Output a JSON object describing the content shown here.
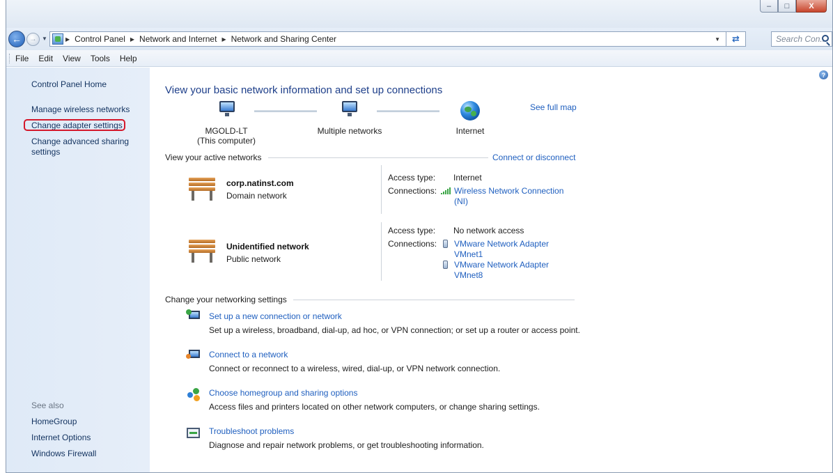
{
  "window": {
    "caption": {
      "minimize": "–",
      "maximize": "□",
      "close": "X"
    }
  },
  "address": {
    "crumbs": [
      "Control Panel",
      "Network and Internet",
      "Network and Sharing Center"
    ],
    "search_placeholder": "Search Con..."
  },
  "menu": [
    "File",
    "Edit",
    "View",
    "Tools",
    "Help"
  ],
  "sidebar": {
    "home": "Control Panel Home",
    "items": [
      "Manage wireless networks",
      "Change adapter settings",
      "Change advanced sharing settings"
    ],
    "see_also_label": "See also",
    "see_also": [
      "HomeGroup",
      "Internet Options",
      "Windows Firewall"
    ]
  },
  "main": {
    "title": "View your basic network information and set up connections",
    "see_full_map": "See full map",
    "map": {
      "computer_name": "MGOLD-LT",
      "computer_sub": "(This computer)",
      "middle": "Multiple networks",
      "internet": "Internet"
    },
    "active_header": "View your active networks",
    "connect_or_disconnect": "Connect or disconnect",
    "networks": [
      {
        "name": "corp.natinst.com",
        "type": "Domain network",
        "access_label": "Access type:",
        "access_value": "Internet",
        "connections_label": "Connections:",
        "connection_1": "Wireless Network Connection",
        "connection_1b": "(NI)"
      },
      {
        "name": "Unidentified network",
        "type": "Public network",
        "access_label": "Access type:",
        "access_value": "No network access",
        "connections_label": "Connections:",
        "connection_1": "VMware Network Adapter",
        "connection_1b": "VMnet1",
        "connection_2": "VMware Network Adapter",
        "connection_2b": "VMnet8"
      }
    ],
    "change_header": "Change your networking settings",
    "tasks": [
      {
        "title": "Set up a new connection or network",
        "desc": "Set up a wireless, broadband, dial-up, ad hoc, or VPN connection; or set up a router or access point."
      },
      {
        "title": "Connect to a network",
        "desc": "Connect or reconnect to a wireless, wired, dial-up, or VPN network connection."
      },
      {
        "title": "Choose homegroup and sharing options",
        "desc": "Access files and printers located on other network computers, or change sharing settings."
      },
      {
        "title": "Troubleshoot problems",
        "desc": "Diagnose and repair network problems, or get troubleshooting information."
      }
    ]
  },
  "colors": {
    "link": "#1f5fbf",
    "title": "#1e3f8a",
    "highlight_ring": "#d4182b",
    "sidebar": "#e3ecf8"
  }
}
